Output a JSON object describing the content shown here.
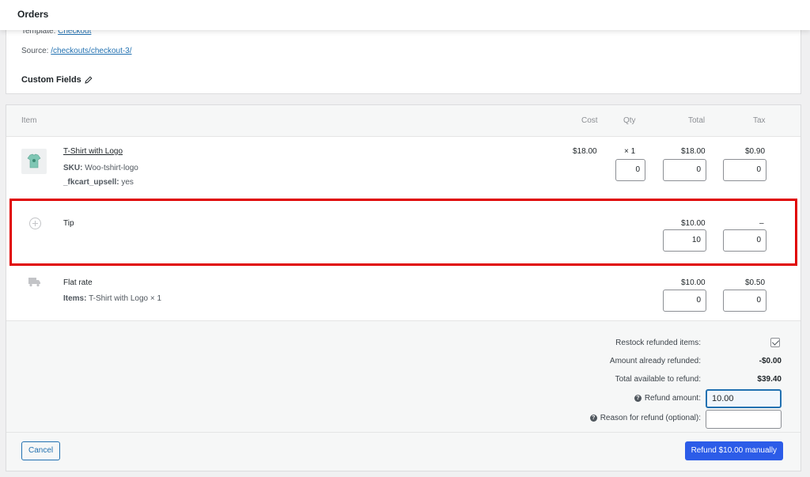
{
  "header": {
    "title": "Orders"
  },
  "meta": {
    "template_label": "Template:",
    "template_link": "Checkout",
    "source_label": "Source:",
    "source_link": "/checkouts/checkout-3/",
    "custom_fields": "Custom Fields"
  },
  "table": {
    "columns": {
      "item": "Item",
      "cost": "Cost",
      "qty": "Qty",
      "total": "Total",
      "tax": "Tax"
    }
  },
  "line_items": {
    "product": {
      "name": "T-Shirt with Logo",
      "sku_label": "SKU:",
      "sku": "Woo-tshirt-logo",
      "meta_label": "_fkcart_upsell:",
      "meta_value": "yes",
      "cost": "$18.00",
      "qty": "× 1",
      "qty_refund": "0",
      "total": "$18.00",
      "total_refund": "0",
      "tax": "$0.90",
      "tax_refund": "0"
    },
    "fee": {
      "name": "Tip",
      "total": "$10.00",
      "total_refund": "10",
      "tax": "–",
      "tax_refund": "0"
    },
    "shipping": {
      "name": "Flat rate",
      "items_label": "Items:",
      "items_value": "T-Shirt with Logo × 1",
      "total": "$10.00",
      "total_refund": "0",
      "tax": "$0.50",
      "tax_refund": "0"
    }
  },
  "refund": {
    "restock_label": "Restock refunded items:",
    "already_label": "Amount already refunded:",
    "already_value": "-$0.00",
    "available_label": "Total available to refund:",
    "available_value": "$39.40",
    "amount_label": "Refund amount:",
    "amount_value": "10.00",
    "reason_label": "Reason for refund (optional):",
    "reason_value": "",
    "cancel": "Cancel",
    "submit": "Refund $10.00 manually"
  },
  "icons": {
    "edit": "pencil-icon",
    "product": "tshirt-thumbnail",
    "fee": "plus-circle-icon",
    "shipping": "truck-icon",
    "help": "question-icon",
    "checkbox": "checkmark"
  },
  "colors": {
    "primary": "#2c5ce8",
    "link": "#2271b1",
    "highlight": "#e00000"
  }
}
